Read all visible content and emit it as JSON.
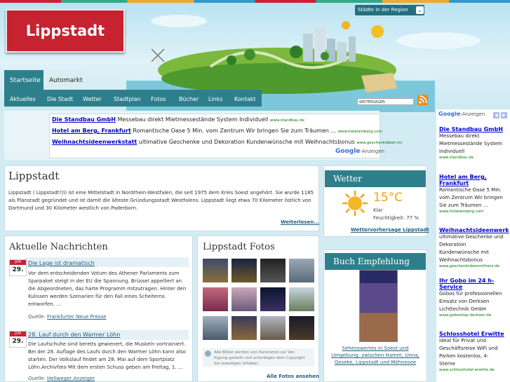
{
  "header": {
    "logo": "Lippstadt",
    "region_select": "Städte in der Region"
  },
  "tabs": [
    {
      "label": "Startseite",
      "active": true
    },
    {
      "label": "Automarkt",
      "active": false
    }
  ],
  "subnav": [
    "Aktuelles",
    "Die Stadt",
    "Wetter",
    "Stadtplan",
    "Fotos",
    "Bücher",
    "Links",
    "Kontakt"
  ],
  "social": {
    "bookmark_label": "WEITERSAGEN",
    "rss": "rss-icon"
  },
  "ads_top": [
    {
      "title": "Die Standbau GmbH",
      "text": "Messebau direkt Mietmessestände System Individuell",
      "url": "www.standbau.de"
    },
    {
      "title": "Hotel am Berg, Frankfurt",
      "text": "Romantische Oase 5 Min. vom Zentrum Wir bringen Sie zum Träumen ...",
      "url": "www.hotelamberg.com"
    },
    {
      "title": "Weihnachtsideenwerkstatt",
      "text": "ultimative Geschenke und Dekoration Kundenwünsche mit Weihnachtsbonus",
      "url": "www.geschenkideen.ml"
    }
  ],
  "google_ads_label": {
    "brand": "Google",
    "suffix": "-Anzeigen"
  },
  "intro": {
    "title": "Lippstadt",
    "text": "Lippstadt ( Lippstadt?/i) ist eine Mittelstadt in Nordrhein-Westfalen, die seit 1975 dem Kreis Soest angehört. Sie wurde 1185 als Planstadt gegründet und ist damit die älteste Gründungsstadt Westfalens. Lippstadt liegt etwa 70 Kilometer östlich von Dortmund und 30 Kilometer westlich von Paderborn.",
    "more": "Weiterlesen..."
  },
  "news": {
    "title": "Aktuelle Nachrichten",
    "items": [
      {
        "month": "JUN",
        "day": "29.",
        "title": "Die Lage ist dramatisch",
        "text": [
          "Vor dem entscheidenden Votum des Athener Parlaments zum",
          "Sparpaket steigt in der EU die Spannung. Brüssel appelliert an",
          "die Abgeordneten, das harte Programm mitzutragen. Hinter den",
          "Kulissen werden Szenarien für den Fall eines Scheiterns",
          "entworfen. ..."
        ],
        "source_label": "Quelle:",
        "source": "Frankfurter Neue Presse"
      },
      {
        "month": "JUN",
        "day": "29.",
        "title": "28. Lauf durch den Warmer Löhn",
        "text": [
          "Die Laufschuhe sind bereits gewienert, die Muskeln vortrainiert.",
          "Bei der 28. Auflage des Laufs durch den Warmer Löhn kann also",
          "starten. Der Volkslauf findet am 28. Mai auf dem Sportplatz",
          "Löhn.Archivfoto Mit dem ersten Schuss geben am Freitag, 1. ..."
        ],
        "source_label": "Quelle:",
        "source": "Hellweger Anzeiger"
      }
    ]
  },
  "photos": {
    "title": "Lippstadt Fotos",
    "note": [
      "Alle Bilder werden von Panoramio zur Ver-",
      "fügung gestellt und unterliegen dem Copyright",
      "der jeweiligen Urheber."
    ],
    "all_link": "Alle Fotos ansehen"
  },
  "weather": {
    "title": "Wetter",
    "temp": "15°C",
    "condition": "Klar",
    "humidity": "Feuchtigkeit: 77 %",
    "link": "Wettervorhersage Lippstadt"
  },
  "book": {
    "title": "Buch Empfehlung",
    "caption": [
      "Sehenswertes in Soest und",
      "Umgebung: zwischen Hamm, Unna,",
      "Geseke, Lippstadt und Möhnesee"
    ]
  },
  "ads_right": {
    "label": {
      "brand": "Google",
      "suffix": "-Anzeigen"
    },
    "items": [
      {
        "title": [
          "Die Standbau GmbH"
        ],
        "desc": [
          "Messebau direkt",
          "Mietmessestände System",
          "Individuell"
        ],
        "url": "www.standbau.de"
      },
      {
        "title": [
          "Hotel am Berg,",
          "Frankfurt"
        ],
        "desc": [
          "Romantische Oase 5 Min.",
          "vom Zentrum Wir bringen",
          "Sie zum Träumen ..."
        ],
        "url": "www.hotelamberg.com"
      },
      {
        "title": [
          "Weihnachtsideenwerk"
        ],
        "desc": [
          "ultimative Geschenke und",
          "Dekoration",
          "Kundenwünsche mit",
          "Weihnachtsbonus"
        ],
        "url": "www.geschenkideenmitherz.de"
      },
      {
        "title": [
          "Ihr Gobo im 24 h-",
          "Service"
        ],
        "desc": [
          "Gobos für professionellen",
          "Einsatz von Derksen",
          "Lichttechnik GmbH"
        ],
        "url": "www.goboshop.derksen.de"
      },
      {
        "title": [
          "Schlosshotel Erwitte"
        ],
        "desc": [
          "Ideal für Privat und",
          "Geschäftsreise WiFi und",
          "Parken kostenlos, 4-",
          "Sterne"
        ],
        "url": "www.schlosshotel-erwitte.de"
      }
    ]
  },
  "colors": {
    "accent": "#2e7f8c",
    "logo_red": "#c62230",
    "link": "#24607f",
    "sun": "#f2a21c"
  }
}
